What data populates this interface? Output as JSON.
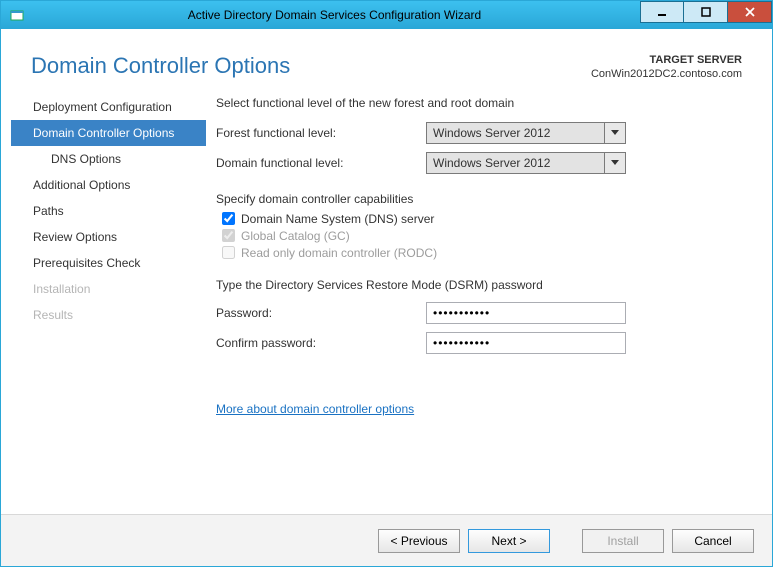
{
  "window": {
    "title": "Active Directory Domain Services Configuration Wizard"
  },
  "header": {
    "page_title": "Domain Controller Options",
    "target_label": "TARGET SERVER",
    "target_value": "ConWin2012DC2.contoso.com"
  },
  "sidebar": {
    "items": [
      {
        "label": "Deployment Configuration",
        "state": "normal"
      },
      {
        "label": "Domain Controller Options",
        "state": "selected"
      },
      {
        "label": "DNS Options",
        "state": "normal",
        "indent": true
      },
      {
        "label": "Additional Options",
        "state": "normal"
      },
      {
        "label": "Paths",
        "state": "normal"
      },
      {
        "label": "Review Options",
        "state": "normal"
      },
      {
        "label": "Prerequisites Check",
        "state": "normal"
      },
      {
        "label": "Installation",
        "state": "disabled"
      },
      {
        "label": "Results",
        "state": "disabled"
      }
    ]
  },
  "main": {
    "functional_level_prompt": "Select functional level of the new forest and root domain",
    "forest_label": "Forest functional level:",
    "forest_value": "Windows Server 2012",
    "domain_label": "Domain functional level:",
    "domain_value": "Windows Server 2012",
    "capabilities_prompt": "Specify domain controller capabilities",
    "capabilities": [
      {
        "label": "Domain Name System (DNS) server",
        "checked": true,
        "enabled": true
      },
      {
        "label": "Global Catalog (GC)",
        "checked": true,
        "enabled": false
      },
      {
        "label": "Read only domain controller (RODC)",
        "checked": false,
        "enabled": false
      }
    ],
    "dsrm_prompt": "Type the Directory Services Restore Mode (DSRM) password",
    "password_label": "Password:",
    "password_value": "•••••••••••",
    "confirm_label": "Confirm password:",
    "confirm_value": "•••••••••••",
    "more_link": "More about domain controller options"
  },
  "footer": {
    "previous": "< Previous",
    "next": "Next >",
    "install": "Install",
    "cancel": "Cancel"
  }
}
